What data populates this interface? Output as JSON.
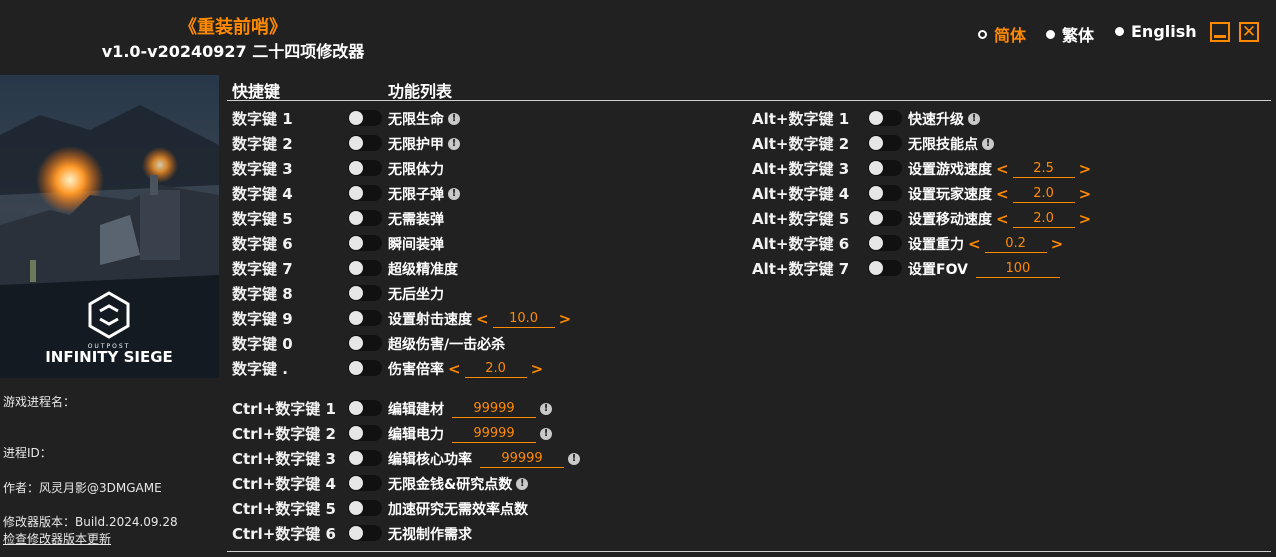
{
  "title": "《重装前哨》",
  "version": "v1.0-v20240927 二十四项修改器",
  "languages": [
    "简体",
    "繁体",
    "English"
  ],
  "cover": {
    "brand_small": "OUTPOST",
    "brand": "INFINITY SIEGE"
  },
  "sidebar": {
    "process_name_label": "游戏进程名：",
    "process_id_label": "进程ID：",
    "author": "作者：风灵月影@3DMGAME",
    "build": "修改器版本：Build.2024.09.28",
    "check_update": "检查修改器版本更新"
  },
  "headers": {
    "hotkey": "快捷键",
    "functions": "功能列表"
  },
  "col1": [
    {
      "key": "数字键 1",
      "name": "无限生命",
      "warn": true
    },
    {
      "key": "数字键 2",
      "name": "无限护甲",
      "warn": true
    },
    {
      "key": "数字键 3",
      "name": "无限体力"
    },
    {
      "key": "数字键 4",
      "name": "无限子弹",
      "warn": true
    },
    {
      "key": "数字键 5",
      "name": "无需装弹"
    },
    {
      "key": "数字键 6",
      "name": "瞬间装弹"
    },
    {
      "key": "数字键 7",
      "name": "超级精准度"
    },
    {
      "key": "数字键 8",
      "name": "无后坐力"
    },
    {
      "key": "数字键 9",
      "name": "设置射击速度",
      "value": "10.0",
      "arrows": true
    },
    {
      "key": "数字键 0",
      "name": "超级伤害/一击必杀"
    },
    {
      "key": "数字键 .",
      "name": "伤害倍率",
      "value": "2.0",
      "arrows": true
    }
  ],
  "col2": [
    {
      "key": "Ctrl+数字键 1",
      "name": "编辑建材",
      "value": "99999",
      "warn": true
    },
    {
      "key": "Ctrl+数字键 2",
      "name": "编辑电力",
      "value": "99999",
      "warn": true
    },
    {
      "key": "Ctrl+数字键 3",
      "name": "编辑核心功率",
      "value": "99999",
      "warn": true
    },
    {
      "key": "Ctrl+数字键 4",
      "name": "无限金钱&研究点数",
      "warn": true
    },
    {
      "key": "Ctrl+数字键 5",
      "name": "加速研究无需效率点数"
    },
    {
      "key": "Ctrl+数字键 6",
      "name": "无视制作需求"
    }
  ],
  "col3": [
    {
      "key": "Alt+数字键 1",
      "name": "快速升级",
      "warn": true
    },
    {
      "key": "Alt+数字键 2",
      "name": "无限技能点",
      "warn": true
    },
    {
      "key": "Alt+数字键 3",
      "name": "设置游戏速度",
      "value": "2.5",
      "arrows": true
    },
    {
      "key": "Alt+数字键 4",
      "name": "设置玩家速度",
      "value": "2.0",
      "arrows": true
    },
    {
      "key": "Alt+数字键 5",
      "name": "设置移动速度",
      "value": "2.0",
      "arrows": true
    },
    {
      "key": "Alt+数字键 6",
      "name": "设置重力",
      "value": "0.2",
      "arrows": true
    },
    {
      "key": "Alt+数字键 7",
      "name": "设置FOV",
      "value": "100"
    }
  ],
  "colors": {
    "accent": "#ff8a00",
    "background": "#212121",
    "toggle_track": "#111111"
  }
}
